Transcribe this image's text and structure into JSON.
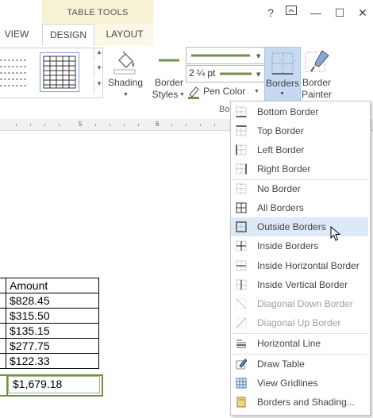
{
  "title_bar": {
    "contextual_group": "TABLE TOOLS",
    "help": "?",
    "restore_ribbon": "⧉",
    "minimize": "—",
    "maximize": "☐",
    "close": "✕"
  },
  "tabs": [
    {
      "label": "VIEW"
    },
    {
      "label": "DESIGN",
      "active": true
    },
    {
      "label": "LAYOUT"
    }
  ],
  "ribbon": {
    "shading_label": "Shading",
    "border_styles_line1": "Border",
    "border_styles_line2": "Styles",
    "line_weight": "2 ¼ pt",
    "pen_color": "Pen Color",
    "borders_label": "Borders",
    "border_painter_line1": "Border",
    "border_painter_line2": "Painter",
    "group_label_fragment": "Bo"
  },
  "ruler": {
    "num5": "5",
    "num6": "6"
  },
  "table": {
    "header": "Amount",
    "rows": [
      "$828.45",
      "$315.50",
      "$135.15",
      "$277.75",
      "$122.33"
    ],
    "total": "$1,679.18"
  },
  "borders_menu": {
    "items": [
      {
        "label": "Bottom Border",
        "icon": "bottom-border-icon",
        "enabled": true
      },
      {
        "label": "Top Border",
        "icon": "top-border-icon",
        "enabled": true
      },
      {
        "label": "Left Border",
        "icon": "left-border-icon",
        "enabled": true
      },
      {
        "label": "Right Border",
        "icon": "right-border-icon",
        "enabled": true
      },
      {
        "label": "No Border",
        "icon": "no-border-icon",
        "enabled": true
      },
      {
        "label": "All Borders",
        "icon": "all-borders-icon",
        "enabled": true
      },
      {
        "label": "Outside Borders",
        "icon": "outside-borders-icon",
        "enabled": true,
        "highlighted": true
      },
      {
        "label": "Inside Borders",
        "icon": "inside-borders-icon",
        "enabled": true
      },
      {
        "label": "Inside Horizontal Border",
        "icon": "inside-horizontal-border-icon",
        "enabled": true
      },
      {
        "label": "Inside Vertical Border",
        "icon": "inside-vertical-border-icon",
        "enabled": true
      },
      {
        "label": "Diagonal Down Border",
        "icon": "diagonal-down-border-icon",
        "enabled": false
      },
      {
        "label": "Diagonal Up Border",
        "icon": "diagonal-up-border-icon",
        "enabled": false
      },
      {
        "label": "Horizontal Line",
        "icon": "horizontal-line-icon",
        "enabled": true
      },
      {
        "label": "Draw Table",
        "icon": "draw-table-icon",
        "enabled": true
      },
      {
        "label": "View Gridlines",
        "icon": "view-gridlines-icon",
        "enabled": true
      },
      {
        "label": "Borders and Shading...",
        "icon": "borders-and-shading-icon",
        "enabled": true
      }
    ]
  },
  "colors": {
    "accent_green": "#72904a",
    "menu_highlight": "#dce9f7",
    "contextual_tab": "#f7f2d4"
  }
}
